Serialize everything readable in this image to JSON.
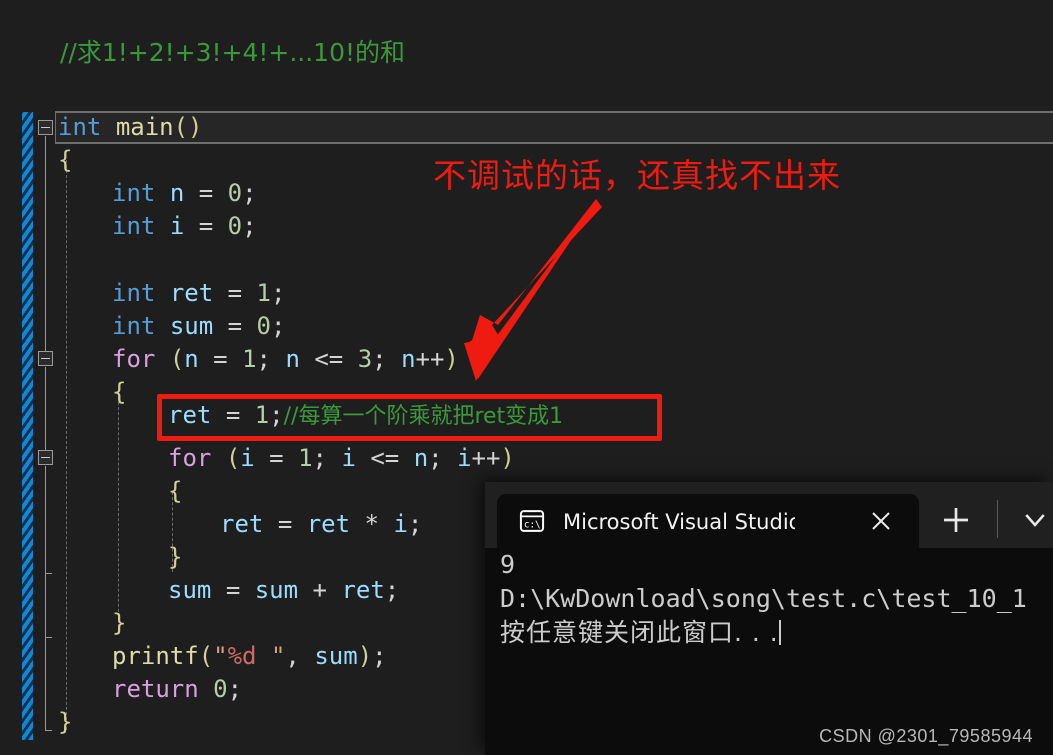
{
  "editor": {
    "comment_top": "//求1!+2!+3!+4!+...10!的和",
    "lines": {
      "main_sig": "int main()",
      "open_brace": "{",
      "decl_n": "int n = 0;",
      "decl_i": "int i = 0;",
      "decl_ret": "int ret = 1;",
      "decl_sum": "int sum = 0;",
      "for_outer": "for (n = 1; n <= 3; n++)",
      "brace_outer_open": "{",
      "ret_reset": "ret = 1;//每算一个阶乘就把ret变成1",
      "ret_reset_code": "ret = 1;",
      "ret_reset_comment": "//每算一个阶乘就把ret变成1",
      "for_inner": "for (i = 1; i <= n; i++)",
      "brace_inner_open": "{",
      "mul": "ret = ret * i;",
      "brace_inner_close": "}",
      "sum_add": "sum = sum + ret;",
      "brace_outer_close": "}",
      "printf": "printf(\"%d \", sum);",
      "return": "return 0;",
      "close_brace": "}"
    },
    "fold_markers": [
      "collapse-main",
      "collapse-for-outer",
      "collapse-for-inner"
    ]
  },
  "annotations": {
    "red_note": "不调试的话，还真找不出来",
    "arrow": "red-arrow-pointing-to-highlighted-line",
    "highlight_box": "red-rectangle-around-ret-reset-line",
    "accent_color": "#f01b10"
  },
  "console": {
    "tab_title": "Microsoft Visual Studio 调试挡",
    "tab_icon": "terminal-icon",
    "close_label": "✕",
    "new_tab_label": "+",
    "dropdown_label": "⌄",
    "output": [
      "9",
      "D:\\KwDownload\\song\\test.c\\test_10_1",
      "按任意键关闭此窗口. . ."
    ]
  },
  "watermark": "CSDN @2301_79585944"
}
